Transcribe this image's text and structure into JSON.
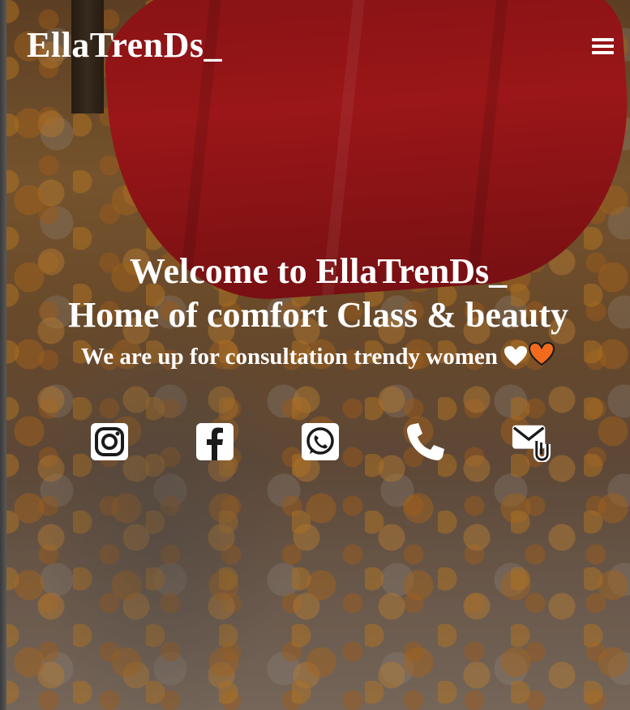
{
  "header": {
    "brand": "EllaTrenDs_",
    "menu_icon": "hamburger-menu-icon"
  },
  "hero": {
    "heading_line1": "Welcome to EllaTrenDs_",
    "heading_line2": "Home of comfort Class & beauty",
    "tagline": "We are up for consultation trendy women",
    "hearts": [
      "white-heart-icon",
      "orange-heart-icon"
    ]
  },
  "socials": [
    {
      "icon": "instagram-icon"
    },
    {
      "icon": "facebook-icon"
    },
    {
      "icon": "whatsapp-icon"
    },
    {
      "icon": "phone-icon"
    },
    {
      "icon": "mail-attachment-icon"
    }
  ],
  "colors": {
    "text": "#ffffff",
    "dress_red": "#b8191d",
    "heart_orange": "#f26b1d"
  }
}
